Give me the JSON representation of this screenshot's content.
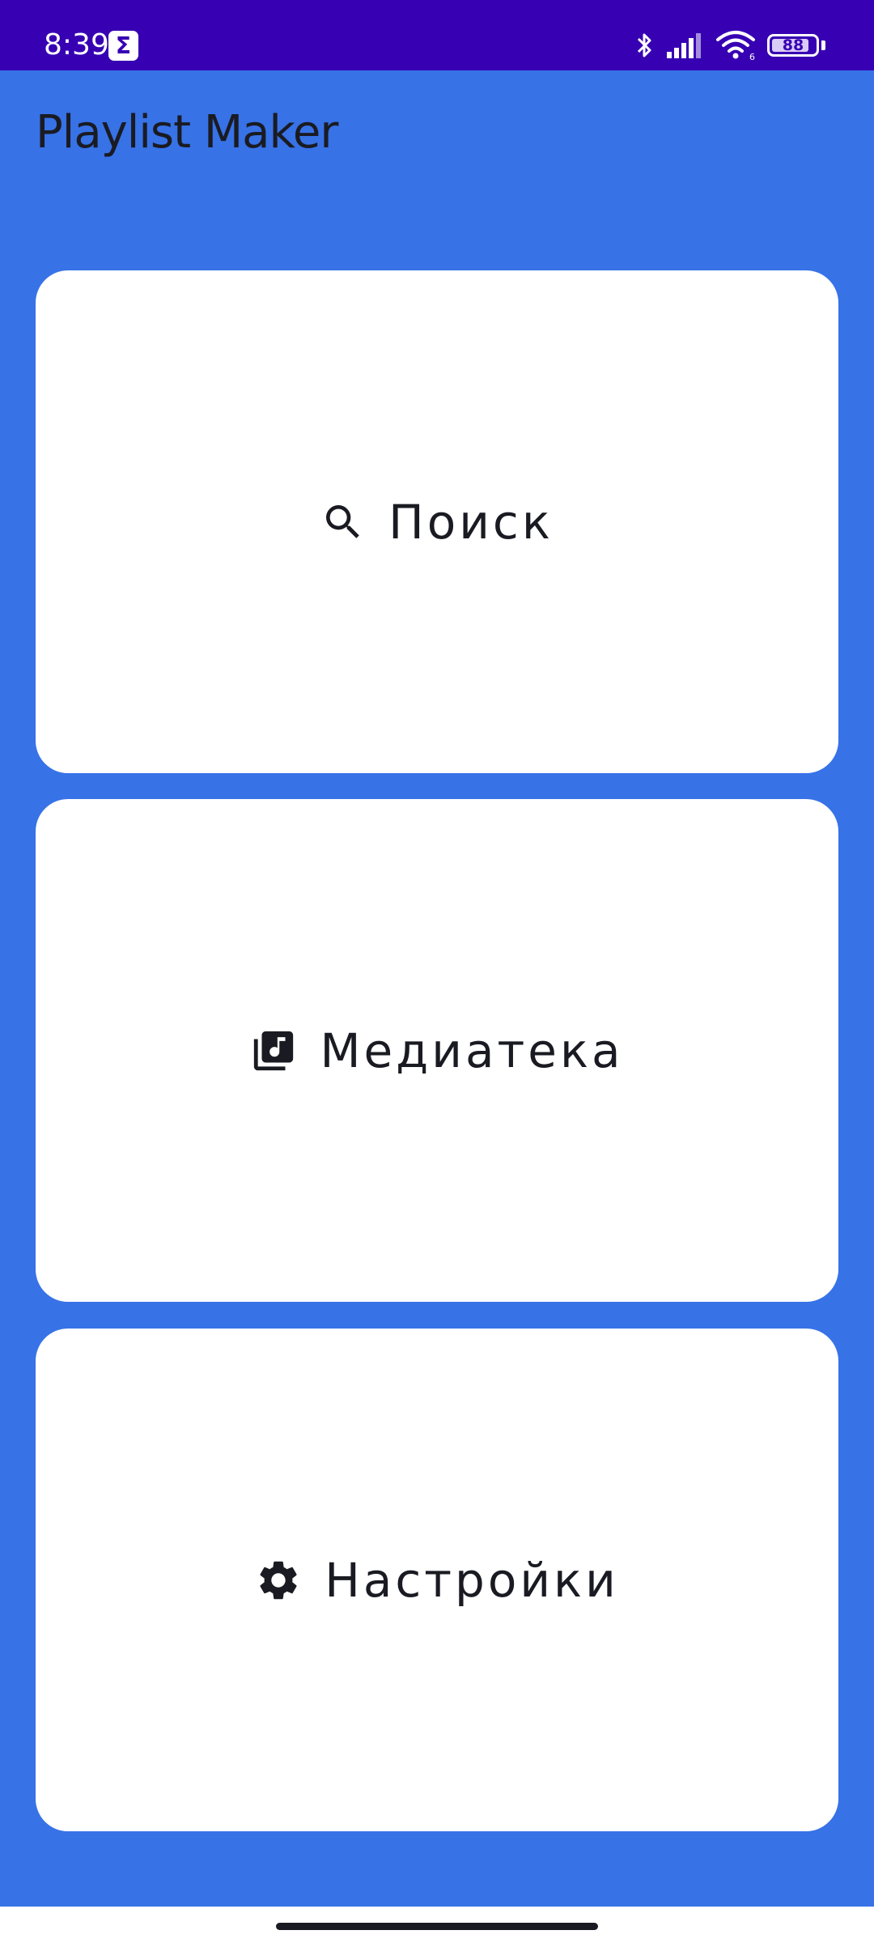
{
  "status_bar": {
    "time": "8:39",
    "app_icon": "sigma-app-icon",
    "battery_level": "88",
    "icons": [
      "bluetooth-icon",
      "signal-icon",
      "wifi-icon",
      "battery-icon"
    ]
  },
  "app": {
    "title": "Playlist Maker"
  },
  "menu": {
    "search_label": "Поиск",
    "search_icon": "search-icon",
    "media_label": "Медиатека",
    "media_icon": "library-music-icon",
    "settings_label": "Настройки",
    "settings_icon": "gear-icon"
  },
  "colors": {
    "background": "#3772E7",
    "status_bar": "#3700B3",
    "card": "#FFFFFF",
    "text": "#1A1B22"
  }
}
